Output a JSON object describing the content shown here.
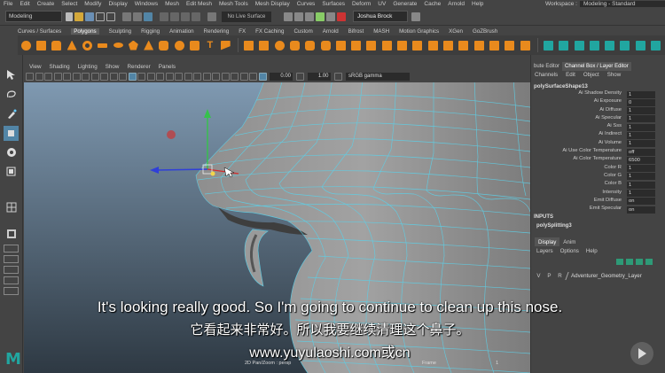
{
  "menubar": {
    "items": [
      "File",
      "Edit",
      "Create",
      "Select",
      "Modify",
      "Display",
      "Windows",
      "Mesh",
      "Edit Mesh",
      "Mesh Tools",
      "Mesh Display",
      "Curves",
      "Surfaces",
      "Deform",
      "UV",
      "Generate",
      "Cache",
      "Arnold",
      "Help"
    ],
    "workspace_label": "Workspace :",
    "workspace_value": "Modeling - Standard"
  },
  "statusline": {
    "mode": "Modeling",
    "live_surface": "No Live Surface",
    "user": "Joshua Brock"
  },
  "shelf": {
    "tabs": [
      "Curves / Surfaces",
      "Polygons",
      "Sculpting",
      "Rigging",
      "Animation",
      "Rendering",
      "FX",
      "FX Caching",
      "Custom",
      "Arnold",
      "Bifrost",
      "MASH",
      "Motion Graphics",
      "XGen",
      "GoZBrush"
    ],
    "active_tab": "Polygons"
  },
  "viewport": {
    "menu": [
      "View",
      "Shading",
      "Lighting",
      "Show",
      "Renderer",
      "Panels"
    ],
    "exposure": "0.00",
    "gamma": "1.00",
    "color_space": "sRGB gamma",
    "camera_label": "2D Pan/Zoom : persp",
    "frame_label": "Frame",
    "frame_value": "1"
  },
  "right_panel": {
    "tabs": [
      "bute Editor",
      "Channel Box / Layer Editor"
    ],
    "active_tab": "Channel Box / Layer Editor",
    "menu": [
      "Channels",
      "Edit",
      "Object",
      "Show"
    ],
    "node": "polySurfaceShape13",
    "attributes": [
      {
        "label": "Ai Shadow Density",
        "value": "1"
      },
      {
        "label": "Ai Exposure",
        "value": "0"
      },
      {
        "label": "Ai Diffuse",
        "value": "1"
      },
      {
        "label": "Ai Specular",
        "value": "1"
      },
      {
        "label": "Ai Sss",
        "value": "1"
      },
      {
        "label": "Ai Indirect",
        "value": "1"
      },
      {
        "label": "Ai Volume",
        "value": "1"
      },
      {
        "label": "Ai Use Color Temperature",
        "value": "off"
      },
      {
        "label": "Ai Color Temperature",
        "value": "6500"
      },
      {
        "label": "Color R",
        "value": "1"
      },
      {
        "label": "Color G",
        "value": "1"
      },
      {
        "label": "Color B",
        "value": "1"
      },
      {
        "label": "Intensity",
        "value": "1"
      },
      {
        "label": "Emit Diffuse",
        "value": "on"
      },
      {
        "label": "Emit Specular",
        "value": "on"
      }
    ],
    "inputs_header": "INPUTS",
    "inputs_node": "polySplitting3",
    "layer_tabs": [
      "Display",
      "Anim"
    ],
    "active_layer_tab": "Display",
    "layer_menu": [
      "Layers",
      "Options",
      "Help"
    ],
    "layer": {
      "v": "V",
      "p": "P",
      "r": "R",
      "name": "Adventurer_Geometry_Layer"
    }
  },
  "subtitles": {
    "english": "It's looking really good. So I'm going to continue to clean up this nose.",
    "chinese": "它看起来非常好。所以我要继续清理这个鼻子。",
    "url": "www.yuyulaoshi.com或cn"
  },
  "colors": {
    "accent": "#21a6a0",
    "shelf_icon": "#e98a1d",
    "active_tool": "#5285a6",
    "wireframe": "#5ecfe6"
  }
}
